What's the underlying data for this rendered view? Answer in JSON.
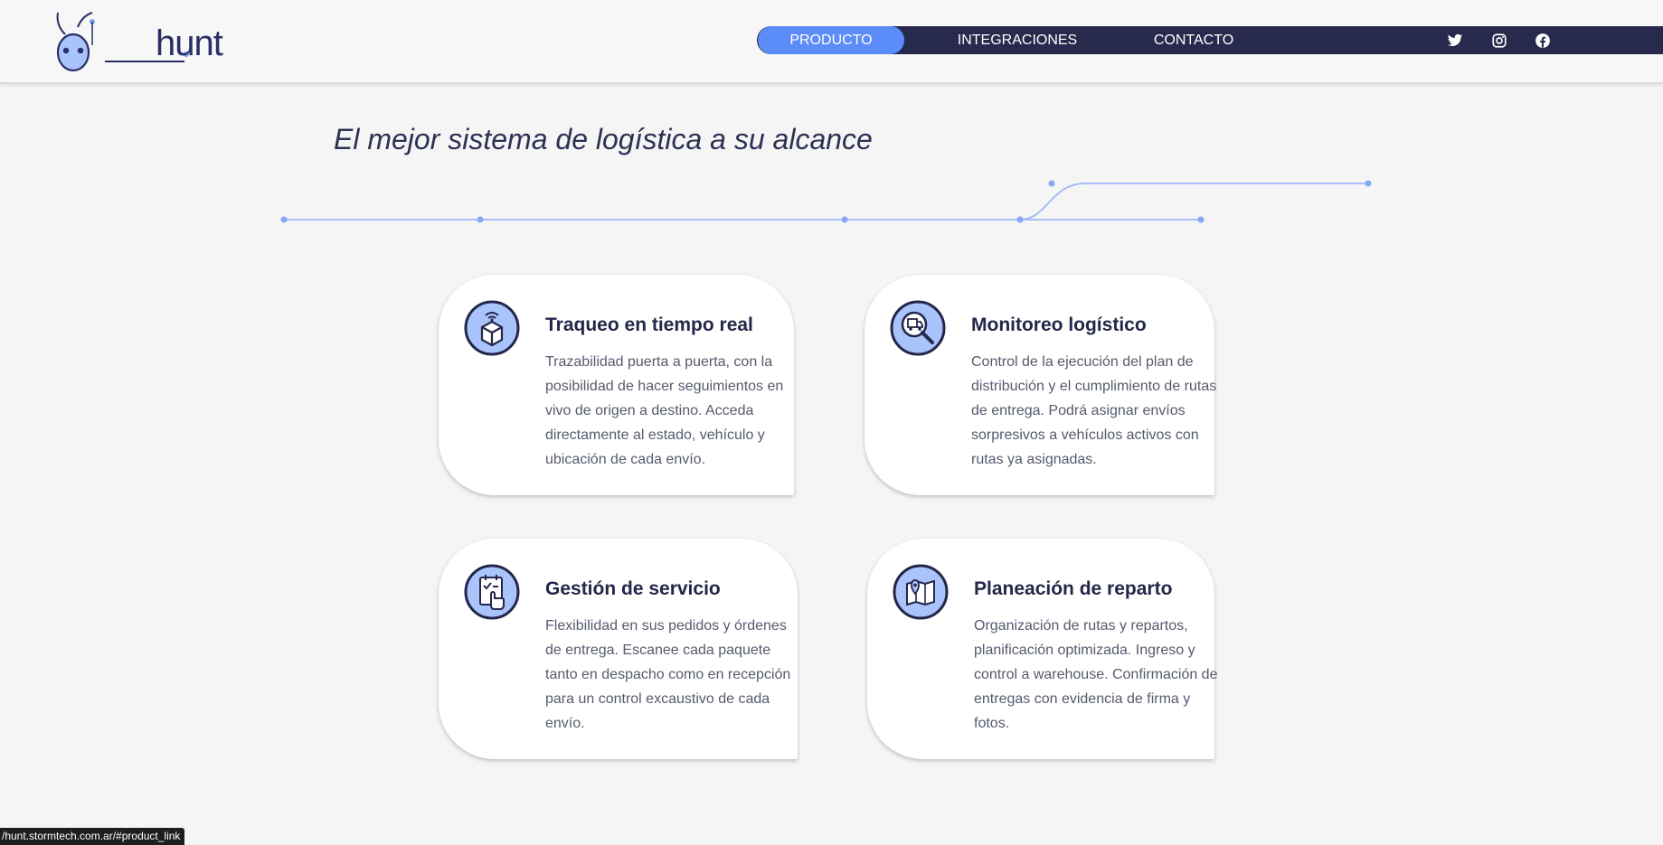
{
  "header": {
    "logo_text": "hunt",
    "nav": [
      {
        "label": "PRODUCTO",
        "active": true
      },
      {
        "label": "INTEGRACIONES",
        "active": false
      },
      {
        "label": "CONTACTO",
        "active": false
      }
    ],
    "social": [
      "twitter-icon",
      "instagram-icon",
      "facebook-icon"
    ]
  },
  "hero": {
    "title": "El mejor sistema de logística a su alcance"
  },
  "cards": [
    {
      "icon": "box-wifi-icon",
      "title": "Traqueo en tiempo real",
      "text": "Trazabilidad puerta a puerta, con la posibilidad de hacer seguimientos en vivo de origen a destino. Acceda directamente al estado, vehículo y ubicación de cada envío."
    },
    {
      "icon": "truck-magnifier-icon",
      "title": "Monitoreo logístico",
      "text": "Control de la ejecución del plan de distribución y el cumplimiento de rutas de entrega. Podrá asignar envíos sorpresivos a vehículos activos con rutas ya asignadas."
    },
    {
      "icon": "checklist-hand-icon",
      "title": "Gestión de servicio",
      "text": "Flexibilidad en sus pedidos y órdenes de entrega. Escanee cada paquete tanto en despacho como en recepción para un control excaustivo de cada envío."
    },
    {
      "icon": "map-pin-icon",
      "title": "Planeación de reparto",
      "text": "Organización de rutas y repartos, planificación optimizada. Ingreso y control a warehouse. Confirmación de entregas con evidencia de firma y fotos."
    }
  ],
  "status_bar": {
    "url": "/hunt.stormtech.com.ar/#product_link"
  },
  "colors": {
    "accent": "#5b8cf7",
    "navy": "#272a4d",
    "icon_fill": "#a9c3fb",
    "line": "#9db8f5"
  }
}
